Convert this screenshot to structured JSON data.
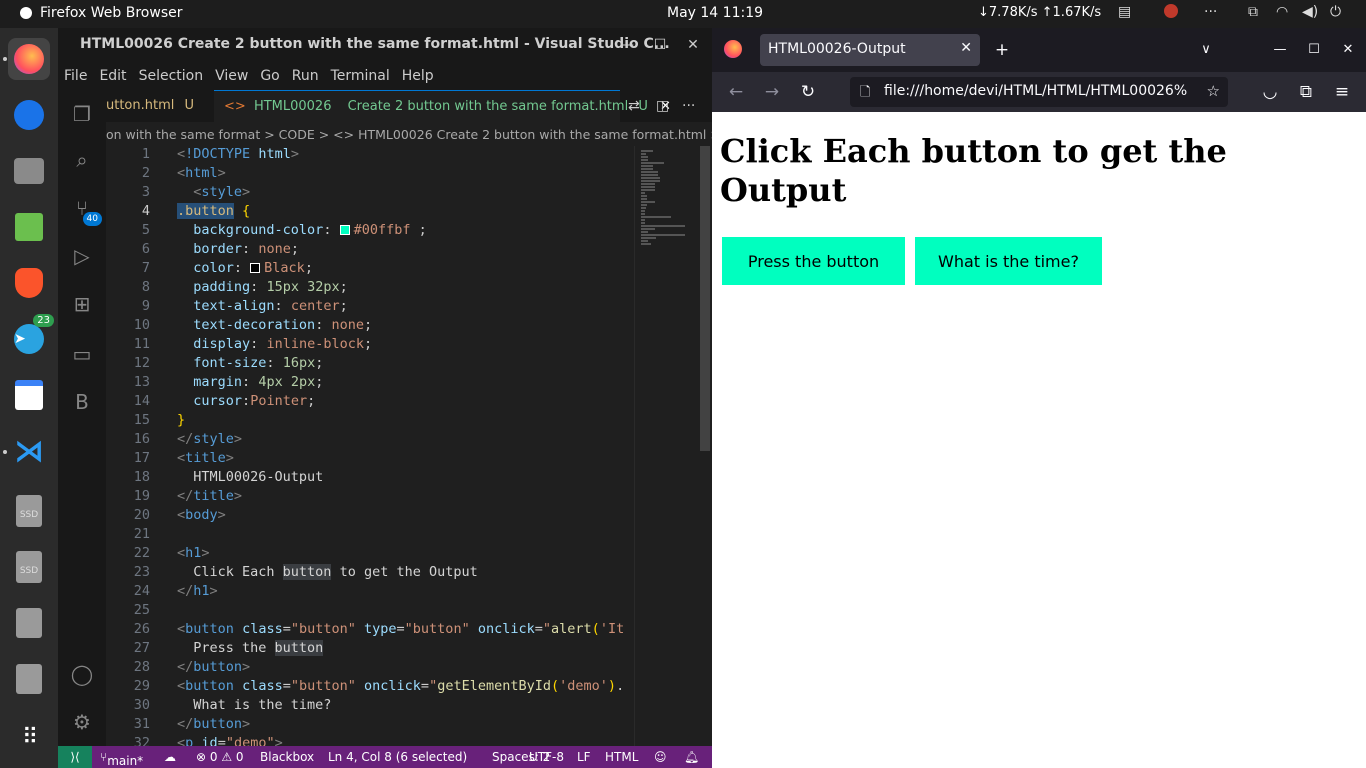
{
  "topbar": {
    "app_name": "Firefox Web Browser",
    "clock": "May 14  11:19",
    "net_speed": "↓7.78K/s ↑1.67K/s"
  },
  "dock": {
    "telegram_badge": "23",
    "ssd_label": "SSD"
  },
  "vscode": {
    "title": "HTML00026 Create 2 button with the same format.html - Visual Studio C...",
    "menu": [
      "File",
      "Edit",
      "Selection",
      "View",
      "Go",
      "Run",
      "Terminal",
      "Help"
    ],
    "scm_badge": "40",
    "account_letter": "B",
    "tabs": [
      {
        "label": "utton.html",
        "flag": "U"
      },
      {
        "folder": "HTML00026",
        "label": "Create 2 button with the same format.html",
        "flag": "U"
      }
    ],
    "breadcrumb": "on with the same format  >  CODE  >  <>  HTML00026    Create 2 button with the same format.html  >",
    "status": {
      "branch": "main*",
      "problems": "⊗ 0 ⚠ 0",
      "theme": "Blackbox",
      "position": "Ln 4, Col 8 (6 selected)",
      "spaces": "Spaces: 2",
      "encoding": "UTF-8",
      "eol": "LF",
      "language": "HTML"
    }
  },
  "code_lines": [
    {
      "n": "1",
      "html": "<span class='pn'>&lt;</span><span class='tg'>!DOCTYPE</span> <span class='pr'>html</span><span class='pn'>&gt;</span>"
    },
    {
      "n": "2",
      "html": "<span class='pn'>&lt;</span><span class='tg'>html</span><span class='pn'>&gt;</span>"
    },
    {
      "n": "3",
      "html": "  <span class='pn'>&lt;</span><span class='tg'>style</span><span class='pn'>&gt;</span>"
    },
    {
      "n": "4",
      "html": "<span class='sel' style='background:#264f78'>.button</span> <span class='br'>{</span>"
    },
    {
      "n": "5",
      "html": "  <span class='pr'>background-color</span>: <span class='swatch' style='background:#00ffbf'></span><span class='vl'>#00ffbf</span> ;"
    },
    {
      "n": "6",
      "html": "  <span class='pr'>border</span>: <span class='vl'>none</span>;"
    },
    {
      "n": "7",
      "html": "  <span class='pr'>color</span>: <span class='swatch' style='background:#000'></span><span class='vl'>Black</span>;"
    },
    {
      "n": "8",
      "html": "  <span class='pr'>padding</span>: <span class='nm'>15px</span> <span class='nm'>32px</span>;"
    },
    {
      "n": "9",
      "html": "  <span class='pr'>text-align</span>: <span class='vl'>center</span>;"
    },
    {
      "n": "10",
      "html": "  <span class='pr'>text-decoration</span>: <span class='vl'>none</span>;"
    },
    {
      "n": "11",
      "html": "  <span class='pr'>display</span>: <span class='vl'>inline-block</span>;"
    },
    {
      "n": "12",
      "html": "  <span class='pr'>font-size</span>: <span class='nm'>16px</span>;"
    },
    {
      "n": "13",
      "html": "  <span class='pr'>margin</span>: <span class='nm'>4px</span> <span class='nm'>2px</span>;"
    },
    {
      "n": "14",
      "html": "  <span class='pr'>cursor</span>:<span class='vl'>Pointer</span>;"
    },
    {
      "n": "15",
      "html": "<span class='br'>}</span>"
    },
    {
      "n": "16",
      "html": "<span class='pn'>&lt;/</span><span class='tg'>style</span><span class='pn'>&gt;</span>"
    },
    {
      "n": "17",
      "html": "<span class='pn'>&lt;</span><span class='tg'>title</span><span class='pn'>&gt;</span>"
    },
    {
      "n": "18",
      "html": "  <span class='txt'>HTML00026-Output</span>"
    },
    {
      "n": "19",
      "html": "<span class='pn'>&lt;/</span><span class='tg'>title</span><span class='pn'>&gt;</span>"
    },
    {
      "n": "20",
      "html": "<span class='pn'>&lt;</span><span class='tg'>body</span><span class='pn'>&gt;</span>"
    },
    {
      "n": "21",
      "html": ""
    },
    {
      "n": "22",
      "html": "<span class='pn'>&lt;</span><span class='tg'>h1</span><span class='pn'>&gt;</span>"
    },
    {
      "n": "23",
      "html": "  <span class='txt'>Click Each <span style='background:#3a3d41'>button</span> to get the Output</span>"
    },
    {
      "n": "24",
      "html": "<span class='pn'>&lt;/</span><span class='tg'>h1</span><span class='pn'>&gt;</span>"
    },
    {
      "n": "25",
      "html": ""
    },
    {
      "n": "26",
      "html": "<span class='pn'>&lt;</span><span class='tg'>button</span> <span class='at'>class</span>=<span class='st'>\"button\"</span> <span class='at'>type</span>=<span class='st'>\"button\"</span> <span class='at'>onclick</span>=<span class='st'>\"</span><span class='fn'>alert</span><span class='br'>(</span><span class='st'>'It</span>"
    },
    {
      "n": "27",
      "html": "  <span class='txt'>Press the <span style='background:#3a3d41'>button</span></span>"
    },
    {
      "n": "28",
      "html": "<span class='pn'>&lt;/</span><span class='tg'>button</span><span class='pn'>&gt;</span>"
    },
    {
      "n": "29",
      "html": "<span class='pn'>&lt;</span><span class='tg'>button</span> <span class='at'>class</span>=<span class='st'>\"button\"</span> <span class='at'>onclick</span>=<span class='st'>\"</span><span class='fn'>getElementById</span><span class='br'>(</span><span class='st'>'demo'</span><span class='br'>)</span>."
    },
    {
      "n": "30",
      "html": "  <span class='txt'>What is the time?</span>"
    },
    {
      "n": "31",
      "html": "<span class='pn'>&lt;/</span><span class='tg'>button</span><span class='pn'>&gt;</span>"
    },
    {
      "n": "32",
      "html": "<span class='pn'>&lt;</span><span class='tg'>p</span> <span class='at'>id</span>=<span class='st'>\"demo\"</span><span class='pn'>&gt;</span>"
    }
  ],
  "firefox": {
    "tab_title": "HTML00026-Output",
    "url": "file:///home/devi/HTML/HTML/HTML00026%",
    "page": {
      "heading": "Click Each button to get the Output",
      "button1": "Press the button",
      "button2": "What is the time?"
    }
  }
}
